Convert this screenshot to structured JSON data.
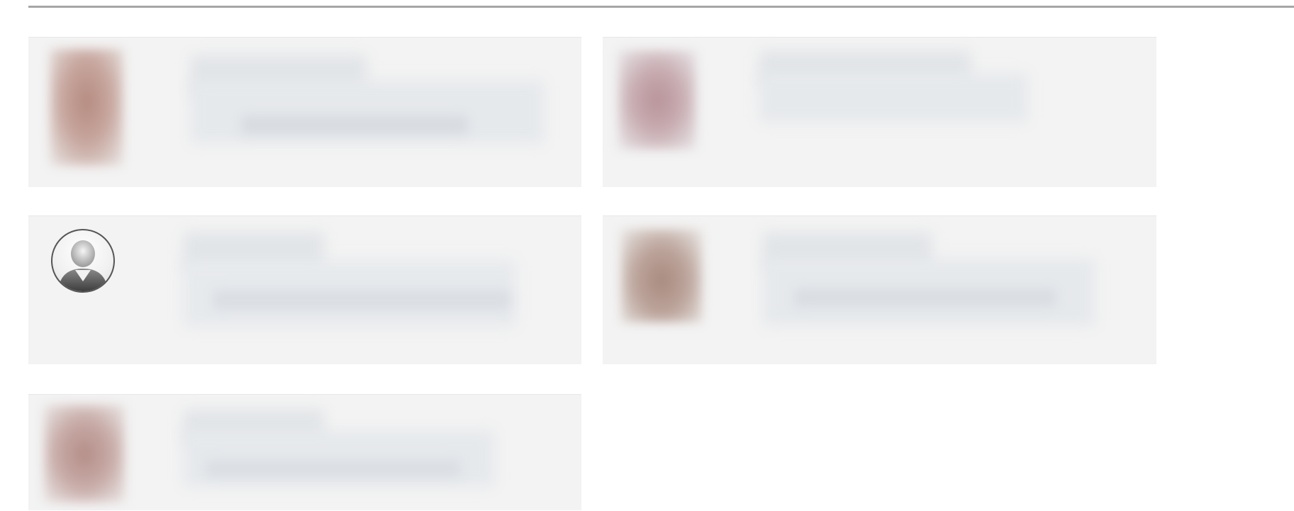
{
  "cards": [
    {
      "name": "contact-card-1",
      "avatar": "photo-avatar"
    },
    {
      "name": "contact-card-2",
      "avatar": "photo-avatar"
    },
    {
      "name": "contact-card-3",
      "avatar": "default-user-icon"
    },
    {
      "name": "contact-card-4",
      "avatar": "photo-avatar"
    },
    {
      "name": "contact-card-5",
      "avatar": "photo-avatar"
    }
  ],
  "colors": {
    "card_background": "#f3f3f3",
    "divider": "#a6a6a6",
    "redacted_text": "#e2e5e8"
  }
}
